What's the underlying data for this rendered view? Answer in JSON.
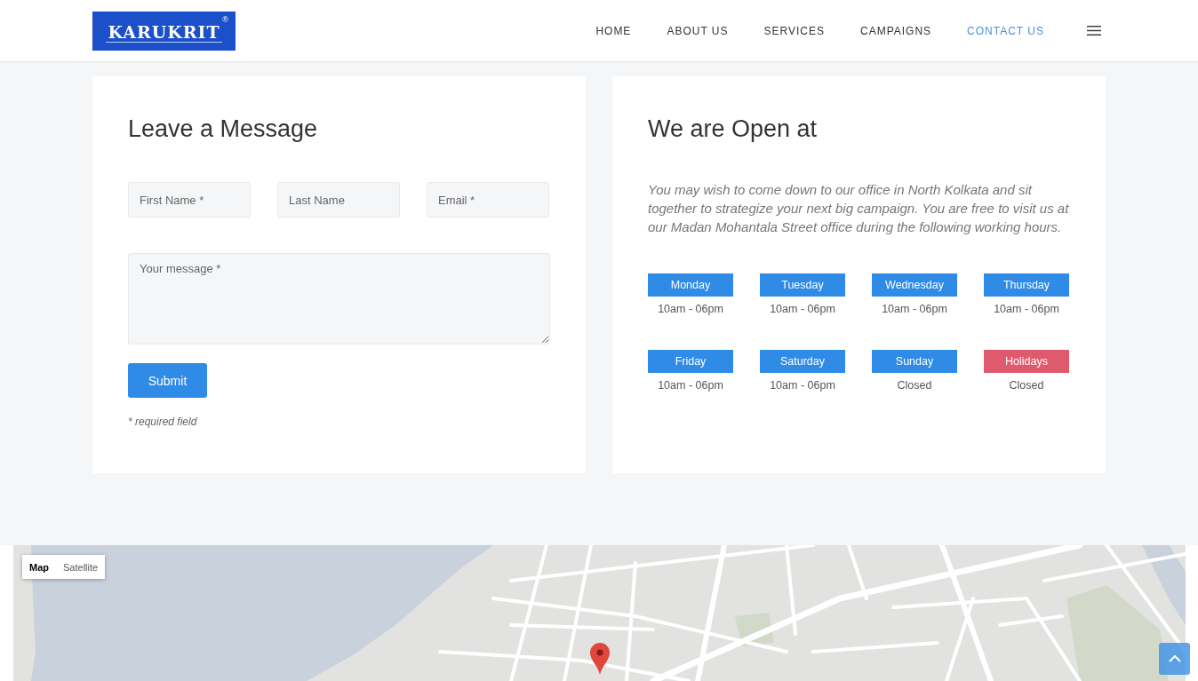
{
  "header": {
    "logo": {
      "text": "KARUKRIT",
      "mark": "®"
    },
    "nav": [
      {
        "label": "HOME",
        "selected": false
      },
      {
        "label": "ABOUT US",
        "selected": false
      },
      {
        "label": "SERVICES",
        "selected": false
      },
      {
        "label": "CAMPAIGNS",
        "selected": false
      },
      {
        "label": "CONTACT US",
        "selected": true
      }
    ]
  },
  "message_form": {
    "title": "Leave a Message",
    "fields": [
      {
        "placeholder": "First Name *"
      },
      {
        "placeholder": "Last Name"
      },
      {
        "placeholder": "Email *"
      }
    ],
    "message": {
      "placeholder": "Your message *"
    },
    "submit": "Submit",
    "note": "* required field"
  },
  "hours": {
    "title": "We are Open at",
    "intro": "You may wish to come down to our office in North Kolkata and sit together to strategize your next big campaign. You are free to visit us at our Madan Mohantala Street office during the following working hours.",
    "days": [
      {
        "day": "Monday",
        "hours": "10am - 06pm",
        "color": "#2f8be6"
      },
      {
        "day": "Tuesday",
        "hours": "10am - 06pm",
        "color": "#2f8be6"
      },
      {
        "day": "Wednesday",
        "hours": "10am - 06pm",
        "color": "#2f8be6"
      },
      {
        "day": "Thursday",
        "hours": "10am - 06pm",
        "color": "#2f8be6"
      },
      {
        "day": "Friday",
        "hours": "10am - 06pm",
        "color": "#2f8be6"
      },
      {
        "day": "Saturday",
        "hours": "10am - 06pm",
        "color": "#2f8be6"
      },
      {
        "day": "Sunday",
        "hours": "Closed",
        "color": "#2f8be6"
      },
      {
        "day": "Holidays",
        "hours": "Closed",
        "color": "#e05a6e"
      }
    ]
  },
  "map": {
    "map_types": [
      {
        "label": "Map",
        "selected": true
      },
      {
        "label": "Satellite",
        "selected": false
      }
    ]
  }
}
